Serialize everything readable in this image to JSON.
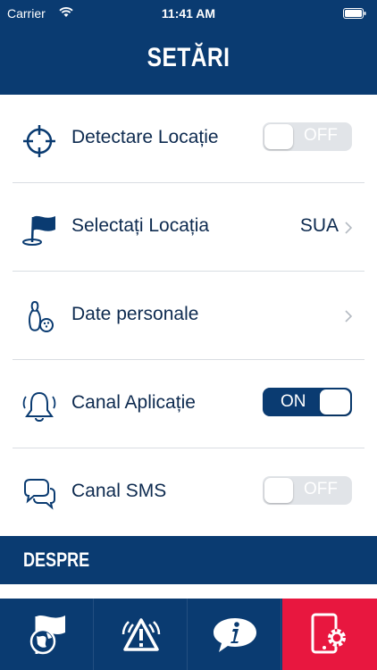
{
  "status_bar": {
    "carrier": "Carrier",
    "time": "11:41 AM"
  },
  "header": {
    "title": "SETĂRI"
  },
  "settings": [
    {
      "label": "Detectare Locație",
      "icon": "crosshair-icon",
      "control": "toggle",
      "toggle_state": "off",
      "toggle_label": "OFF"
    },
    {
      "label": "Selectați Locația",
      "icon": "flag-icon",
      "control": "disclosure",
      "value": "SUA"
    },
    {
      "label": "Date personale",
      "icon": "bowling-pins-icon",
      "control": "disclosure"
    },
    {
      "label": "Canal Aplicație",
      "icon": "bell-icon",
      "control": "toggle",
      "toggle_state": "on",
      "toggle_label": "ON"
    },
    {
      "label": "Canal SMS",
      "icon": "chat-bubbles-icon",
      "control": "toggle",
      "toggle_state": "off",
      "toggle_label": "OFF"
    }
  ],
  "section": {
    "title": "DESPRE"
  },
  "tabbar": {
    "tabs": [
      {
        "icon": "globe-flag-icon"
      },
      {
        "icon": "warning-alert-icon"
      },
      {
        "icon": "info-chat-icon"
      },
      {
        "icon": "settings-device-icon",
        "active": true
      }
    ]
  },
  "colors": {
    "brand": "#0a3b71",
    "accent": "#e8173f",
    "toggle_off": "#e1e4e8"
  }
}
